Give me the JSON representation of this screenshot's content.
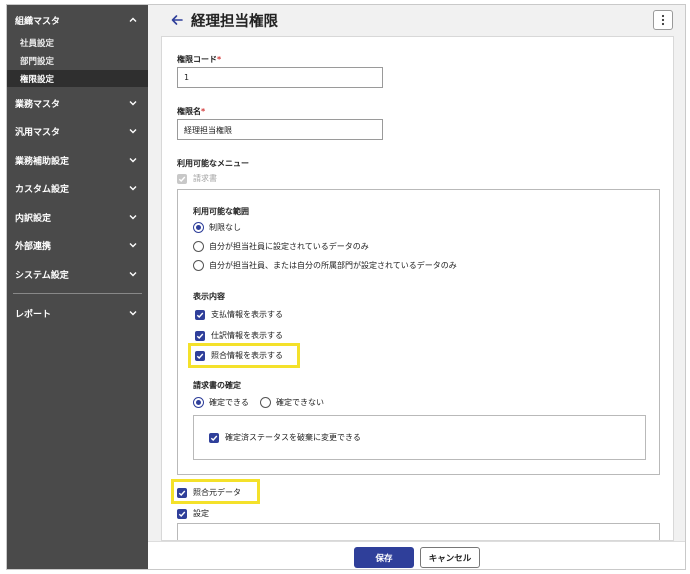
{
  "sidebar": {
    "groups": [
      {
        "label": "組織マスタ",
        "expanded": true
      },
      {
        "label": "業務マスタ"
      },
      {
        "label": "汎用マスタ"
      },
      {
        "label": "業務補助設定"
      },
      {
        "label": "カスタム設定"
      },
      {
        "label": "内訳設定"
      },
      {
        "label": "外部連携"
      },
      {
        "label": "システム設定"
      },
      {
        "label": "レポート"
      }
    ],
    "sub_items": [
      {
        "label": "社員設定"
      },
      {
        "label": "部門設定"
      },
      {
        "label": "権限設定",
        "active": true
      }
    ]
  },
  "header": {
    "title": "経理担当権限"
  },
  "form": {
    "code_label": "権限コード",
    "code_value": "1",
    "name_label": "権限名",
    "name_value": "経理担当権限",
    "required_mark": "*",
    "menu_label": "利用可能なメニュー",
    "menu_invoice": "請求書",
    "scope_label": "利用可能な範囲",
    "scope_options": [
      "制限なし",
      "自分が担当社員に設定されているデータのみ",
      "自分が担当社員、または自分の所属部門が設定されているデータのみ"
    ],
    "scope_selected": 0,
    "display_label": "表示内容",
    "display_options": [
      "支払情報を表示する",
      "仕訳情報を表示する",
      "照合情報を表示する"
    ],
    "confirm_label": "請求書の確定",
    "confirm_options": [
      "確定できる",
      "確定できない"
    ],
    "confirm_selected": 0,
    "confirm_sub": "確定済ステータスを破棄に変更できる",
    "match_source": "照合元データ",
    "settings": "設定"
  },
  "footer": {
    "save_label": "保存",
    "cancel_label": "キャンセル"
  },
  "colors": {
    "sidebar_bg": "#4a4a4a",
    "accent": "#2f3f9a",
    "highlight": "#f4e12a",
    "required": "#d23a3a"
  }
}
